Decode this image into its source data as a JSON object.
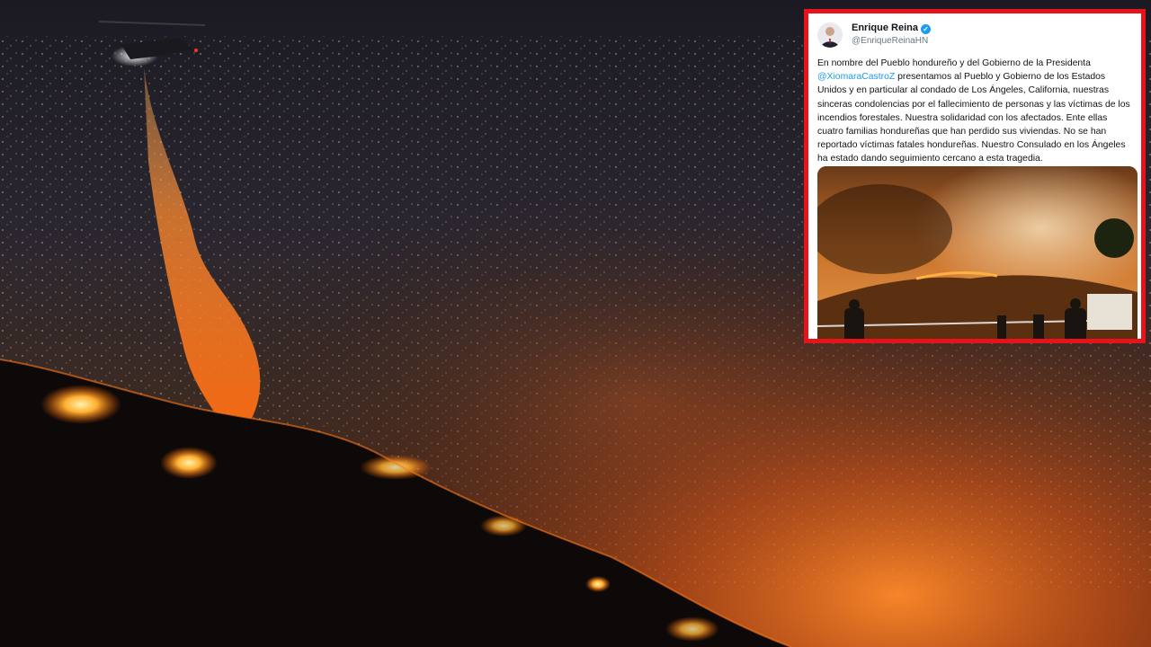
{
  "tweet": {
    "author_name": "Enrique Reina",
    "author_handle": "@EnriqueReinaHN",
    "verified_icon": "verified-badge-icon",
    "text_before_mention": "En nombre del Pueblo hondureño y del Gobierno de la Presidenta ",
    "mention": "@XiomaraCastroZ",
    "text_after_mention": " presentamos al Pueblo y Gobierno de los Estados Unidos y en particular al condado de Los Ángeles, California, nuestras sinceras condolencias por el fallecimiento de personas y las víctimas de los incendios forestales. Nuestra solidaridad con los afectados. Ente ellas cuatro familias hondureñas que han perdido sus viviendas. No se han reportado víctimas fatales hondureñas. Nuestro Consulado en los Ángeles ha estado dando seguimiento cercano a esta tragedia."
  },
  "colors": {
    "frame_border": "#e8121a",
    "mention": "#1d9bf0",
    "fire": "#ff7a18"
  }
}
